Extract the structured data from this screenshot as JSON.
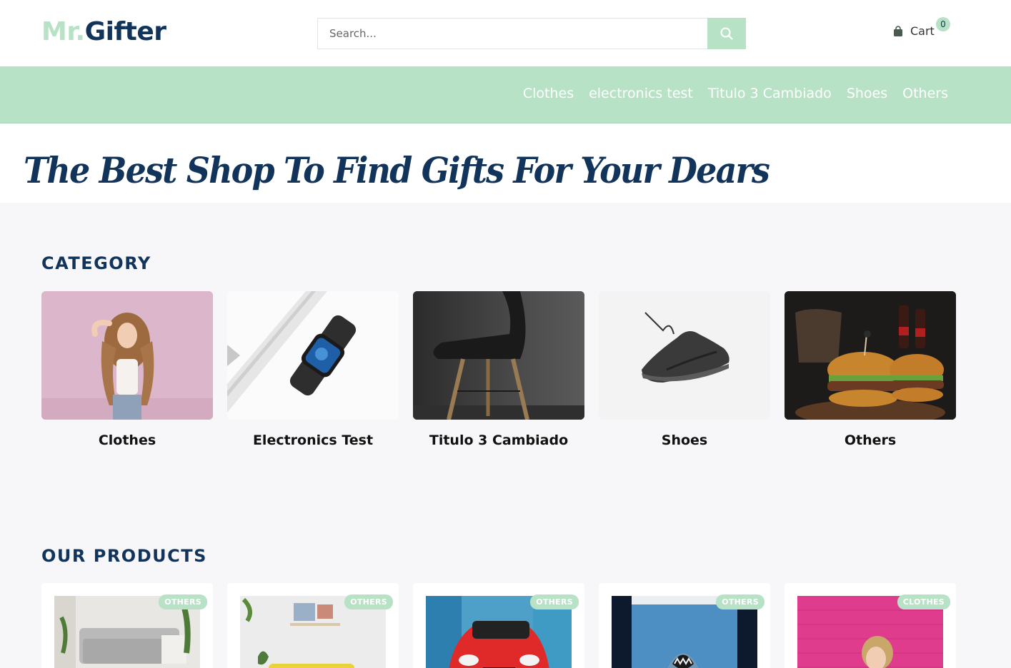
{
  "header": {
    "logo_part1": "Mr.",
    "logo_part2": "Gifter",
    "search_placeholder": "Search...",
    "search_icon": "search-icon",
    "cart_icon": "shopping-bag-icon",
    "cart_label": "Cart",
    "cart_count": "0"
  },
  "nav": {
    "items": [
      "Clothes",
      "electronics test",
      "Titulo 3 Cambiado",
      "Shoes",
      "Others"
    ]
  },
  "hero": {
    "title": "The Best Shop To Find Gifts For Your Dears"
  },
  "categories": {
    "title": "CATEGORY",
    "items": [
      {
        "name": "Clothes"
      },
      {
        "name": "Electronics Test"
      },
      {
        "name": "Titulo 3 Cambiado"
      },
      {
        "name": "Shoes"
      },
      {
        "name": "Others"
      }
    ]
  },
  "products": {
    "title": "OUR PRODUCTS",
    "items": [
      {
        "badge": "OTHERS"
      },
      {
        "badge": "OTHERS"
      },
      {
        "badge": "OTHERS"
      },
      {
        "badge": "OTHERS"
      },
      {
        "badge": "CLOTHES"
      }
    ]
  },
  "colors": {
    "accent": "#b8e2c6",
    "brand_dark": "#13345a",
    "content_bg": "#f7f7f9"
  }
}
